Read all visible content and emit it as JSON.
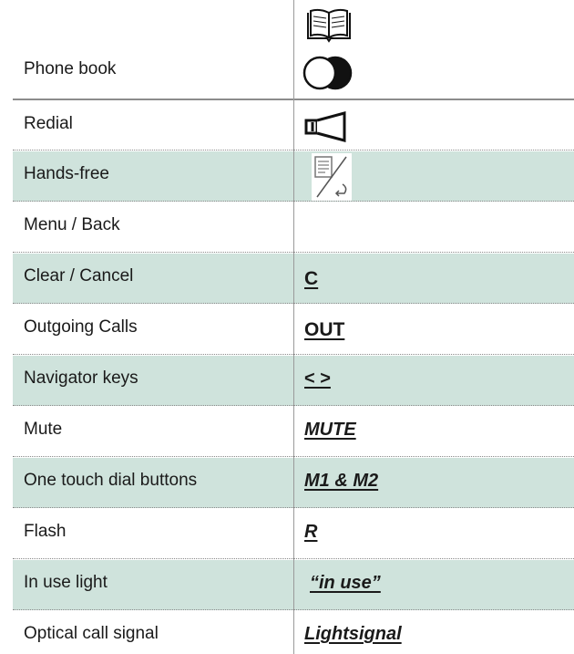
{
  "rows": [
    {
      "label": "Phone book",
      "symbol": "",
      "icon": "dual-circle-icon"
    },
    {
      "label": "Redial",
      "symbol": "",
      "icon": "speaker-icon"
    },
    {
      "label": "Hands-free",
      "symbol": "",
      "icon": "note-back-icon"
    },
    {
      "label": "Menu / Back",
      "symbol": "",
      "icon": ""
    },
    {
      "label": "Clear / Cancel",
      "symbol": "C",
      "icon": ""
    },
    {
      "label": "Outgoing Calls",
      "symbol": "OUT",
      "icon": ""
    },
    {
      "label": "Navigator keys",
      "symbol": "< >",
      "icon": ""
    },
    {
      "label": "Mute",
      "symbol": "MUTE",
      "icon": ""
    },
    {
      "label": "One touch dial buttons",
      "symbol": "M1 & M2",
      "icon": ""
    },
    {
      "label": "Flash",
      "symbol": "R",
      "icon": ""
    },
    {
      "label": "In use light",
      "symbol": "“in use”",
      "icon": ""
    },
    {
      "label": "Optical call signal",
      "symbol": "Lightsignal",
      "icon": ""
    }
  ],
  "header_icon": "open-book-icon",
  "colors": {
    "shade": "#cfe3dc",
    "rule": "#8c8c8c"
  }
}
